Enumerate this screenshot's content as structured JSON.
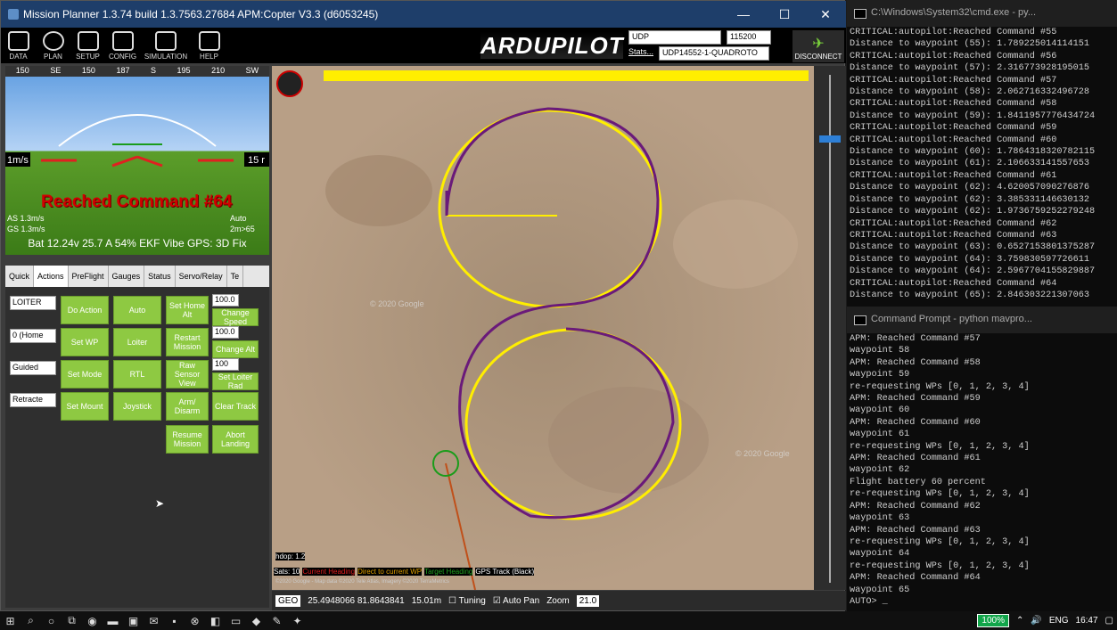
{
  "mp": {
    "title": "Mission Planner 1.3.74 build 1.3.7563.27684 APM:Copter V3.3 (d6053245)",
    "menu": [
      "DATA",
      "PLAN",
      "SETUP",
      "CONFIG",
      "SIMULATION",
      "HELP"
    ],
    "logo": "ARDUPILOT",
    "conn": {
      "type": "UDP",
      "baud": "115200",
      "stats": "Stats...",
      "port": "UDP14552-1-QUADROTO",
      "disconnect": "DISCONNECT"
    },
    "hud": {
      "message": "Reached Command #64",
      "speed_left": "1m/s",
      "speed_right": "15 r",
      "as": "AS 1.3m/s",
      "gs": "GS 1.3m/s",
      "mode": "Auto",
      "dist": "2m>65",
      "bottom": "Bat 12.24v 25.7 A 54% EKF Vibe GPS: 3D Fix",
      "heading": [
        "150",
        "SE",
        "150",
        "187",
        "S",
        "195",
        "210",
        "SW"
      ]
    },
    "tabs": [
      "Quick",
      "Actions",
      "PreFlight",
      "Gauges",
      "Status",
      "Servo/Relay",
      "Te"
    ],
    "actions": {
      "dd1": "LOITER",
      "dd2": "0 (Home",
      "dd3": "Guided",
      "dd4": "Retracte",
      "buttons": [
        "Do Action",
        "Auto",
        "Set Home Alt",
        "Change Speed",
        "Set WP",
        "Loiter",
        "Restart Mission",
        "Change Alt",
        "Set Mode",
        "RTL",
        "Raw Sensor View",
        "Set Loiter Rad",
        "Set Mount",
        "Joystick",
        "Arm/ Disarm",
        "Clear Track",
        "Resume Mission",
        "Abort Landing"
      ],
      "num1": "100.0",
      "num2": "100.0",
      "num3": "100"
    },
    "map": {
      "hdop": "hdop: 1.2",
      "sats": "Sats: 10",
      "legend": [
        "Current Heading",
        "Direct to current WP",
        "Target Heading",
        "GPS Track (Black)"
      ],
      "credits": "©2020 Google - Map data ©2020 Tele Atlas, Imagery ©2020 TerraMetrics",
      "g1": "© 2020 Google",
      "g2": "© 2020 Google"
    },
    "mapbar": {
      "mode": "GEO",
      "coords": "25.4948066 81.8643841",
      "alt": "15.01m",
      "tuning": "Tuning",
      "autopan": "Auto Pan",
      "zoom_label": "Zoom",
      "zoom": "21.0"
    },
    "colors": {
      "yellow": "#ffee00",
      "purple": "#6a1a7a",
      "green": "#20b020"
    }
  },
  "cmd1": {
    "title": "C:\\Windows\\System32\\cmd.exe - py...",
    "lines": [
      "CRITICAL:autopilot:Reached Command #55",
      "Distance to waypoint (55): 1.789225014114151",
      "CRITICAL:autopilot:Reached Command #56",
      "Distance to waypoint (57): 2.316773928195015",
      "CRITICAL:autopilot:Reached Command #57",
      "Distance to waypoint (58): 2.062716332496728",
      "CRITICAL:autopilot:Reached Command #58",
      "Distance to waypoint (59): 1.8411957776434724",
      "CRITICAL:autopilot:Reached Command #59",
      "CRITICAL:autopilot:Reached Command #60",
      "Distance to waypoint (60): 1.7864318320782115",
      "Distance to waypoint (61): 2.106633141557653",
      "CRITICAL:autopilot:Reached Command #61",
      "Distance to waypoint (62): 4.620057090276876",
      "Distance to waypoint (62): 3.385331146630132",
      "Distance to waypoint (62): 1.9736759252279248",
      "CRITICAL:autopilot:Reached Command #62",
      "CRITICAL:autopilot:Reached Command #63",
      "Distance to waypoint (63): 0.6527153801375287",
      "Distance to waypoint (64): 3.759830597726611",
      "Distance to waypoint (64): 2.5967704155829887",
      "CRITICAL:autopilot:Reached Command #64",
      "Distance to waypoint (65): 2.846303221307063"
    ]
  },
  "cmd2": {
    "title": "Command Prompt - python mavpro...",
    "lines": [
      "APM: Reached Command #57",
      "waypoint 58",
      "APM: Reached Command #58",
      "waypoint 59",
      "re-requesting WPs [0, 1, 2, 3, 4]",
      "APM: Reached Command #59",
      "waypoint 60",
      "APM: Reached Command #60",
      "waypoint 61",
      "re-requesting WPs [0, 1, 2, 3, 4]",
      "APM: Reached Command #61",
      "waypoint 62",
      "Flight battery 60 percent",
      "re-requesting WPs [0, 1, 2, 3, 4]",
      "APM: Reached Command #62",
      "waypoint 63",
      "APM: Reached Command #63",
      "re-requesting WPs [0, 1, 2, 3, 4]",
      "waypoint 64",
      "re-requesting WPs [0, 1, 2, 3, 4]",
      "APM: Reached Command #64",
      "waypoint 65",
      "AUTO> _"
    ]
  },
  "taskbar": {
    "battery": "100%",
    "lang": "ENG",
    "time": "16:47"
  }
}
